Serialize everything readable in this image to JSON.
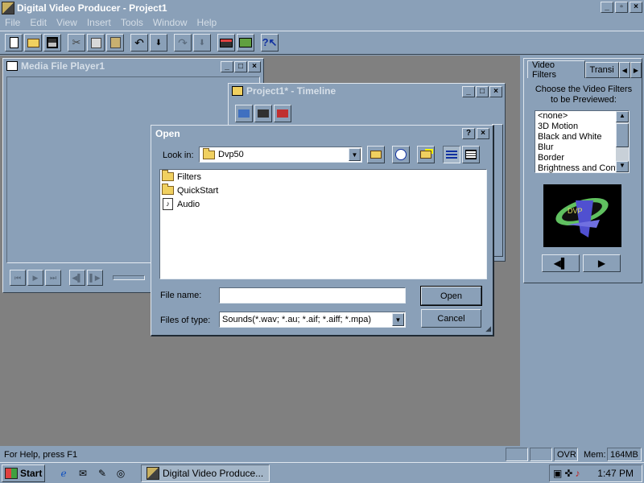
{
  "app": {
    "title": "Digital Video Producer - Project1",
    "caption_buttons": [
      "_",
      "▫",
      "×"
    ]
  },
  "menu": [
    "File",
    "Edit",
    "View",
    "Insert",
    "Tools",
    "Window",
    "Help"
  ],
  "toolbar_icons": [
    "new-icon",
    "open-icon",
    "save-icon",
    "cut-icon",
    "copy-icon",
    "paste-icon",
    "undo-icon",
    "redo-icon",
    "capture-icon",
    "storyboard-icon",
    "help-icon"
  ],
  "player": {
    "title": "Media File Player1",
    "controls": [
      "⏮",
      "▶",
      "⏭",
      "◀▌",
      "▌▶"
    ]
  },
  "timeline": {
    "title": "Project1* - Timeline"
  },
  "dialog": {
    "title": "Open",
    "help_btn": "?",
    "close_btn": "×",
    "look_in_label": "Look in:",
    "look_in_value": "Dvp50",
    "files": [
      {
        "name": "Filters",
        "type": "folder"
      },
      {
        "name": "QuickStart",
        "type": "folder"
      },
      {
        "name": "Audio",
        "type": "audio"
      }
    ],
    "file_name_label": "File name:",
    "file_name_value": "",
    "files_of_type_label": "Files of type:",
    "files_of_type_value": "Sounds(*.wav; *.au; *.aif; *.aiff; *.mpa)",
    "open_btn": "Open",
    "cancel_btn": "Cancel"
  },
  "right_panel": {
    "tabs": [
      "Video Filters",
      "Transi"
    ],
    "instruction": "Choose the Video Filters to be Previewed:",
    "filters": [
      "<none>",
      "3D Motion",
      "Black and White",
      "Blur",
      "Border",
      "Brightness and Contr"
    ],
    "prev_btn": "◀▌",
    "next_btn": "▶"
  },
  "status": {
    "help": "For Help, press F1",
    "ovr": "OVR",
    "mem_label": "Mem:",
    "mem_value": "164MB"
  },
  "taskbar": {
    "start": "Start",
    "task": "Digital Video Produce...",
    "clock": "1:47 PM"
  }
}
